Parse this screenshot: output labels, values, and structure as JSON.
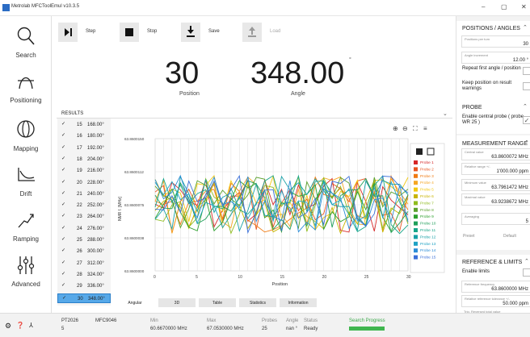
{
  "window": {
    "title": "Metrolab MFCToolEmul v10.3.5",
    "min": "–",
    "max": "▢",
    "close": "✕"
  },
  "nav": [
    {
      "label": "Search",
      "icon": "search-icon"
    },
    {
      "label": "Positioning",
      "icon": "positioning-icon"
    },
    {
      "label": "Mapping",
      "icon": "mapping-icon"
    },
    {
      "label": "Drift",
      "icon": "drift-icon"
    },
    {
      "label": "Ramping",
      "icon": "ramping-icon"
    },
    {
      "label": "Advanced",
      "icon": "advanced-icon"
    }
  ],
  "toolbar": {
    "step": "Step",
    "stop": "Stop",
    "save": "Save",
    "load": "Load"
  },
  "readout": {
    "position": "30",
    "position_label": "Position",
    "angle": "348.00",
    "angle_unit": "°",
    "angle_label": "Angle"
  },
  "results": {
    "title": "RESULTS",
    "rows": [
      {
        "n": "15",
        "deg": "168.00°"
      },
      {
        "n": "16",
        "deg": "180.00°"
      },
      {
        "n": "17",
        "deg": "192.00°"
      },
      {
        "n": "18",
        "deg": "204.00°"
      },
      {
        "n": "19",
        "deg": "216.00°"
      },
      {
        "n": "20",
        "deg": "228.00°"
      },
      {
        "n": "21",
        "deg": "240.00°"
      },
      {
        "n": "22",
        "deg": "252.00°"
      },
      {
        "n": "23",
        "deg": "264.00°"
      },
      {
        "n": "24",
        "deg": "276.00°"
      },
      {
        "n": "25",
        "deg": "288.00°"
      },
      {
        "n": "26",
        "deg": "300.00°"
      },
      {
        "n": "27",
        "deg": "312.00°"
      },
      {
        "n": "28",
        "deg": "324.00°"
      },
      {
        "n": "29",
        "deg": "336.00°"
      },
      {
        "n": "30",
        "deg": "348.00°"
      }
    ],
    "tabs": [
      "Angular",
      "3D",
      "Table",
      "Statistics",
      "Information"
    ]
  },
  "chart_data": {
    "type": "line",
    "xlabel": "Position",
    "ylabel": "NMR f. [MHz]",
    "xticks": [
      "0",
      "5",
      "10",
      "15",
      "20",
      "25",
      "30"
    ],
    "yticks": [
      "63.8600150",
      "63.8600112",
      "63.8600075",
      "63.8600038",
      "63.8600000"
    ],
    "xlim": [
      0,
      30
    ],
    "ylim": [
      63.86,
      63.860015
    ],
    "grid": true,
    "legend_placement": "right",
    "series": [
      {
        "name": "Probe 1",
        "color": "#d62728"
      },
      {
        "name": "Probe 2",
        "color": "#e8531e"
      },
      {
        "name": "Probe 3",
        "color": "#f07a12"
      },
      {
        "name": "Probe 4",
        "color": "#f5a623"
      },
      {
        "name": "Probe 5",
        "color": "#f2c80f"
      },
      {
        "name": "Probe 6",
        "color": "#c8b400"
      },
      {
        "name": "Probe 7",
        "color": "#8fbc1e"
      },
      {
        "name": "Probe 8",
        "color": "#5aa02c"
      },
      {
        "name": "Probe 9",
        "color": "#2ca02c"
      },
      {
        "name": "Probe 10",
        "color": "#1f9e5a"
      },
      {
        "name": "Probe 11",
        "color": "#17a589"
      },
      {
        "name": "Probe 12",
        "color": "#16a0a6"
      },
      {
        "name": "Probe 13",
        "color": "#1fa2c4"
      },
      {
        "name": "Probe 14",
        "color": "#2b8cd6"
      },
      {
        "name": "Probe 15",
        "color": "#3a6fd8"
      }
    ]
  },
  "right": {
    "positions": {
      "title": "POSITIONS / ANGLES",
      "per_turn_label": "Positions per turn",
      "per_turn": "30",
      "inc_label": "Angle increment",
      "inc": "12.00 °",
      "repeat": "Repeat first angle / position",
      "keep": "Keep position on result warnings"
    },
    "probe": {
      "title": "PROBE",
      "enable": "Enable central probe ( probe WR 25 )"
    },
    "range": {
      "title": "MEASUREMENT RANGE",
      "central_label": "Central value",
      "central": "63.8600072 MHz",
      "relrange_label": "Relative range +/-",
      "relrange": "1'000.000 ppm",
      "min_label": "Minimum value",
      "min": "63.7961472 MHz",
      "max_label": "Maximal value",
      "max": "63.9238672 MHz",
      "avg_label": "Averaging",
      "avg": "5",
      "preset": "Preset",
      "default": "Default"
    },
    "ref": {
      "title": "REFERENCE & LIMITS",
      "enable": "Enable limits",
      "reffreq_label": "Reference frequency",
      "reffreq": "63.8600000 MHz",
      "reltol_label": "Relative reference tolerance +/-",
      "reltol": "50.000 ppm",
      "more_label": "Trig. Reversed total value"
    }
  },
  "status": {
    "device1": "PT2026",
    "device1_val": "5",
    "device2": "MFC9046",
    "device2_val": "",
    "min_h": "Min",
    "min_v": "60.6670000 MHz",
    "max_h": "Max",
    "max_v": "67.0530000 MHz",
    "probes_h": "Probes",
    "probes_v": "25",
    "angle_h": "Angle",
    "angle_v": "nan °",
    "status_h": "Status",
    "status_v": "Ready",
    "search_h": "Search Progress"
  }
}
